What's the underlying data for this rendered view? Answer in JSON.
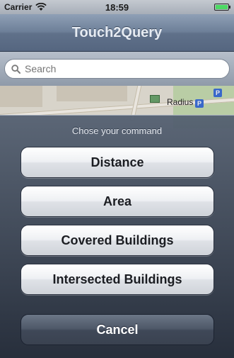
{
  "status_bar": {
    "carrier": "Carrier",
    "time": "18:59"
  },
  "nav_bar": {
    "title": "Touch2Query"
  },
  "search": {
    "placeholder": "Search"
  },
  "map": {
    "labels": {
      "radius": "Radius"
    }
  },
  "action_sheet": {
    "title": "Chose your command",
    "buttons": [
      "Distance",
      "Area",
      "Covered Buildings",
      "Intersected Buildings"
    ],
    "cancel_label": "Cancel"
  },
  "colors": {
    "nav_bar": "#6d7f98",
    "sheet_background": "#3a4558",
    "button_light": "#eef0f3",
    "cancel_button": "#4d5767",
    "battery_fill": "#4cd964"
  }
}
